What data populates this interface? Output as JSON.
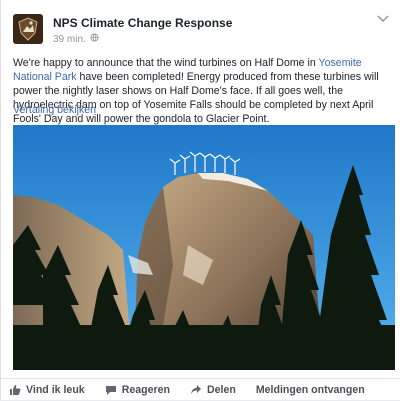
{
  "post": {
    "page_name": "NPS Climate Change Response",
    "time": "39 min.",
    "text_before_link": "We're happy to announce that the wind turbines on Half Dome in ",
    "link_text": "Yosemite National Park",
    "text_after_link": " have been completed! Energy produced from these turbines will power the nightly laser shows on Half Dome's face. If all goes well, the hydroelectric dam on top of Yosemite Falls should be completed by next April Fools' Day and will power the gondola to Glacier Point.",
    "translate_label": "Vertaling bekijken"
  },
  "actions": {
    "like": "Vind ik leuk",
    "comment": "Reageren",
    "share": "Delen",
    "notifications": "Meldingen ontvangen"
  },
  "colors": {
    "link": "#4267b2",
    "sky": "#2f8fd8"
  }
}
